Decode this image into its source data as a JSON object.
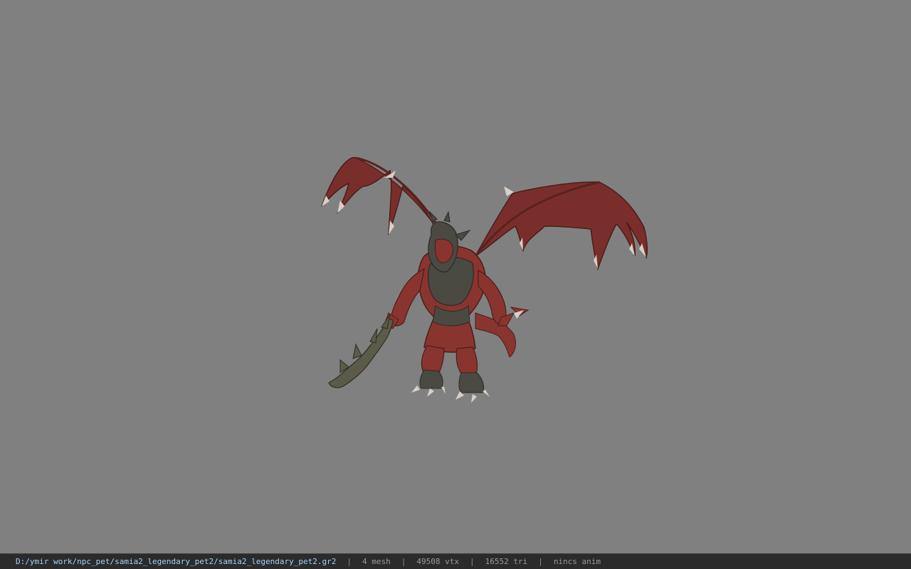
{
  "viewport": {
    "background_color": "#808080",
    "model": {
      "name": "samia2_legendary_pet2",
      "description_icon": "winged-red-dragon-demon-with-serrated-sword",
      "colors": {
        "skin": "#8a3430",
        "wing_membrane": "#7a2e2b",
        "armor": "#4a4a42",
        "sword": "#5c5a48",
        "claws": "#d8cfc8"
      }
    }
  },
  "status_bar": {
    "file_path": "D:/ymir work/npc_pet/samia2_legendary_pet2/samia2_legendary_pet2.gr2",
    "separator": "|",
    "mesh": "4 mesh",
    "vertices": "49508 vtx",
    "triangles": "16552 tri",
    "animation": "nincs anim",
    "colors": {
      "background": "#2b2b2b",
      "path_text": "#9fd3ff",
      "stat_text": "#9a9a9a"
    }
  }
}
